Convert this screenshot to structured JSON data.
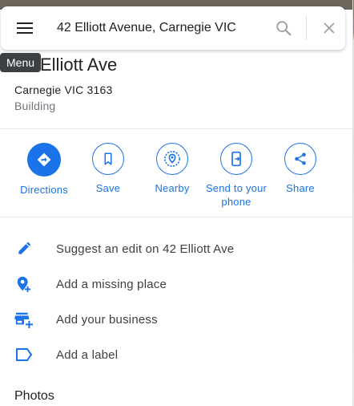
{
  "search": {
    "value": "42 Elliott Avenue, Carnegie VIC"
  },
  "tooltip": {
    "menu": "Menu"
  },
  "place": {
    "title": "42 Elliott Ave",
    "title_visible": "Elliott Ave",
    "address": "Carnegie VIC 3163",
    "type": "Building"
  },
  "actions": [
    {
      "label": "Directions",
      "icon": "directions-icon"
    },
    {
      "label": "Save",
      "icon": "bookmark-icon"
    },
    {
      "label": "Nearby",
      "icon": "nearby-icon"
    },
    {
      "label": "Send to your phone",
      "icon": "send-to-phone-icon"
    },
    {
      "label": "Share",
      "icon": "share-icon"
    }
  ],
  "list": [
    {
      "label": "Suggest an edit on 42 Elliott Ave",
      "icon": "pencil-icon"
    },
    {
      "label": "Add a missing place",
      "icon": "add-place-icon"
    },
    {
      "label": "Add your business",
      "icon": "add-business-icon"
    },
    {
      "label": "Add a label",
      "icon": "label-icon"
    }
  ],
  "photos_heading": "Photos",
  "colors": {
    "accent": "#1a73e8",
    "text": "#202124",
    "muted": "#70757a"
  }
}
